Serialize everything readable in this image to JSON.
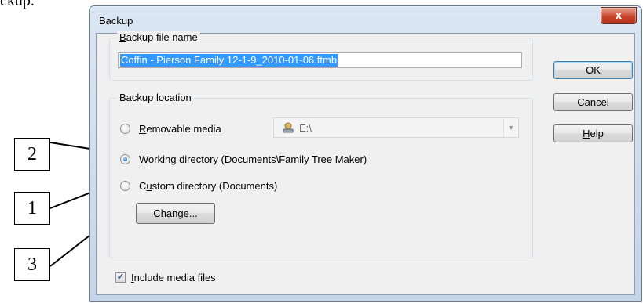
{
  "document": {
    "fragment": "ckup."
  },
  "callouts": [
    "2",
    "1",
    "3"
  ],
  "window": {
    "title": "Backup",
    "close_glyph": "x"
  },
  "backup_file": {
    "group_label_key": "B",
    "group_label_rest": "ackup file name",
    "value": "Coffin - Pierson Family 12-1-9_2010-01-06.ftmb"
  },
  "location": {
    "group_label": "Backup location",
    "options": [
      {
        "key": "R",
        "rest": "emovable media",
        "selected": false
      },
      {
        "key": "W",
        "rest": "orking directory (Documents\\Family Tree Maker)",
        "selected": true
      },
      {
        "pre": "C",
        "key": "u",
        "rest": "stom directory (Documents)",
        "selected": false
      }
    ],
    "removable_drive": "E:\\",
    "change_key": "C",
    "change_rest": "hange..."
  },
  "include_media": {
    "key": "I",
    "rest": "nclude media files",
    "checked": true
  },
  "buttons": {
    "ok": "OK",
    "cancel": "Cancel",
    "help_key": "H",
    "help_rest": "elp"
  },
  "colors": {
    "selection": "#3399ff",
    "close": "#c9462b",
    "dialog_bg": "#f0f0f0"
  }
}
